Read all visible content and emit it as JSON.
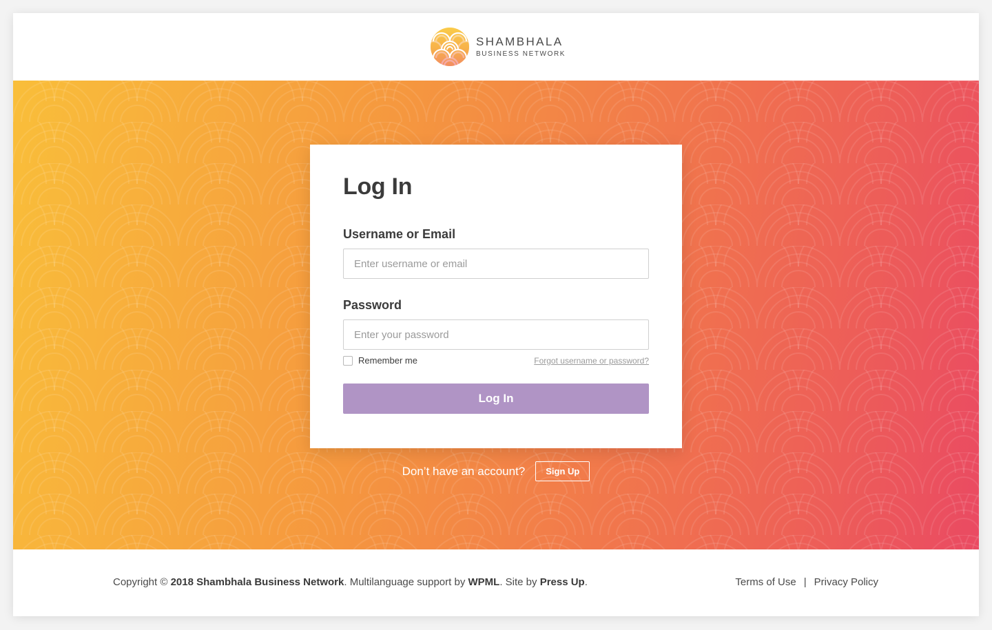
{
  "brand": {
    "name_line1": "SHAMBHALA",
    "name_line2": "BUSINESS NETWORK",
    "colors": {
      "logo_yellow": "#f7c23a",
      "logo_orange": "#f28a3a",
      "logo_red": "#e9506a"
    }
  },
  "login_card": {
    "title": "Log In",
    "username_label": "Username or Email",
    "username_placeholder": "Enter username or email",
    "username_value": "",
    "password_label": "Password",
    "password_placeholder": "Enter your password",
    "password_value": "",
    "remember_label": "Remember me",
    "remember_checked": false,
    "forgot_link": "Forgot username or password?",
    "submit_label": "Log In",
    "submit_color": "#b094c5"
  },
  "signup": {
    "prompt": "Don’t have an account?",
    "button_label": "Sign Up"
  },
  "footer": {
    "copyright_prefix": "Copyright © ",
    "copyright_org": "2018 Shambhala Business Network",
    "multilang_text": ". Multilanguage support by ",
    "multilang_org": "WPML",
    "site_by_text": ". Site by ",
    "site_by_org": "Press Up",
    "end_text": ".",
    "links": [
      "Terms of Use",
      "Privacy Policy"
    ],
    "separator": "|"
  },
  "hero": {
    "gradient_colors": [
      "#f9be3a",
      "#f5973f",
      "#f0704f",
      "#ea4a62"
    ]
  }
}
